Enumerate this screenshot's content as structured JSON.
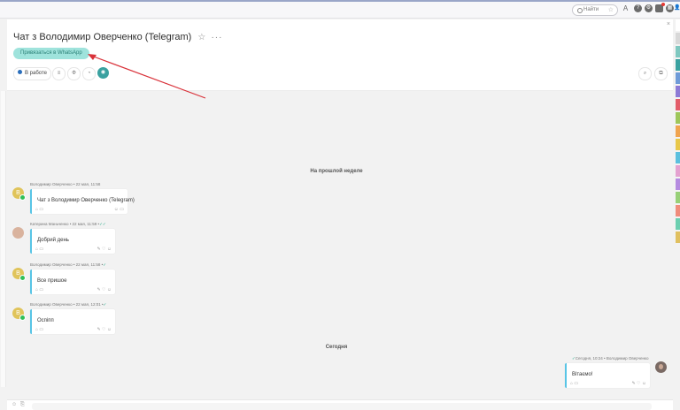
{
  "topbar": {
    "search_placeholder": "Найти",
    "search_star": "☆",
    "icons": [
      "font-icon",
      "help-icon",
      "settings-icon",
      "notifications-icon",
      "apps-icon",
      "profile-icon"
    ],
    "notification_count": ""
  },
  "header": {
    "title": "Чат з Володимир Оверченко (Telegram)",
    "favorite_star": "☆",
    "more": "···",
    "whatsapp_button": "Привязаться в WhatsApp",
    "close": "×",
    "tabs": [
      {
        "label": "В работе",
        "name": "tab-status"
      },
      {
        "label": "≡",
        "name": "tab-list"
      },
      {
        "label": "Ф",
        "name": "tab-phi"
      },
      {
        "label": "◔",
        "name": "tab-clock"
      },
      {
        "label": "◉",
        "name": "tab-active"
      }
    ],
    "right_tools": [
      "⌕",
      "⧉"
    ]
  },
  "rail_colors": [
    "#ffffff",
    "#d8d8d8",
    "#7fc8c0",
    "#3aa1a0",
    "#6f9bd8",
    "#8d7ad6",
    "#e35d6a",
    "#9ec65a",
    "#f0a44f",
    "#e8c84a",
    "#5bc0de",
    "#e4a1d0",
    "#b58be0",
    "#97d077",
    "#f08c7c",
    "#6ccfb0",
    "#e0c060"
  ],
  "chat": {
    "divider_last_week": "На прошлой неделе",
    "divider_today": "Сегодня",
    "messages": [
      {
        "author_meta": "Володимир Оверченко • 22 мая, 11:58",
        "text": "Чат з Володимир Оверченко (Telegram)",
        "avatar_letter": "В",
        "read": ""
      },
      {
        "author_meta": "Катерина Маньченко • 22 мая, 11:59 •",
        "text": "Добрий день",
        "avatar_letter": "",
        "read": "✓✓"
      },
      {
        "author_meta": "Володимир Оверченко • 22 мая, 11:58 •",
        "text": "Все пришое",
        "avatar_letter": "В",
        "read": "✓"
      },
      {
        "author_meta": "Володимир Оверченко • 22 мая, 12:01 •",
        "text": "Оспіпп",
        "avatar_letter": "В",
        "read": "✓"
      }
    ],
    "outgoing": {
      "author_meta": "Сегодня, 10:24 • Володимир Оверченко",
      "read": "✓",
      "text": "Вітаємо!"
    },
    "bubble_icons_left": "⌂ ▭",
    "bubble_icons_right": "✎ ♡ ☺"
  },
  "footer": {
    "icons": [
      "☺",
      "⎘"
    ]
  }
}
